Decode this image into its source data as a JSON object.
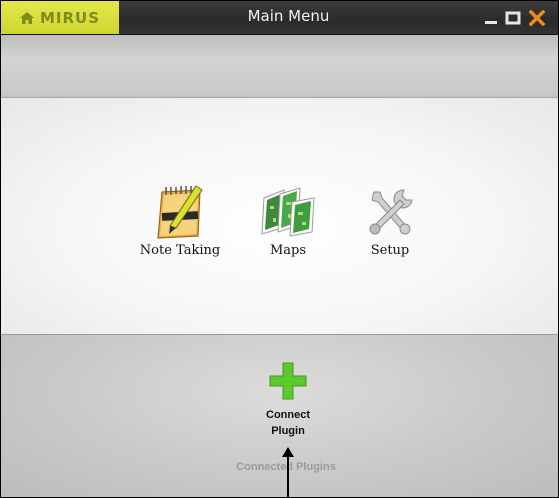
{
  "window": {
    "title": "Main Menu",
    "logo_text": "MIRUS",
    "controls": [
      "minimize-icon",
      "maximize-icon",
      "close-icon"
    ],
    "colors": {
      "logo_bg": "#d8de3a",
      "close": "#f08a1c",
      "titlebar": "#333333"
    }
  },
  "menu": {
    "items": [
      {
        "label": "Note Taking",
        "icon": "notepad-icon"
      },
      {
        "label": "Maps",
        "icon": "maps-icon"
      },
      {
        "label": "Setup",
        "icon": "tools-icon"
      }
    ]
  },
  "plugins": {
    "connect_line1": "Connect",
    "connect_line2": "Plugin",
    "connect_icon": "plus-icon",
    "connected_label": "Connected Plugins",
    "accent": "#5cc92e"
  }
}
